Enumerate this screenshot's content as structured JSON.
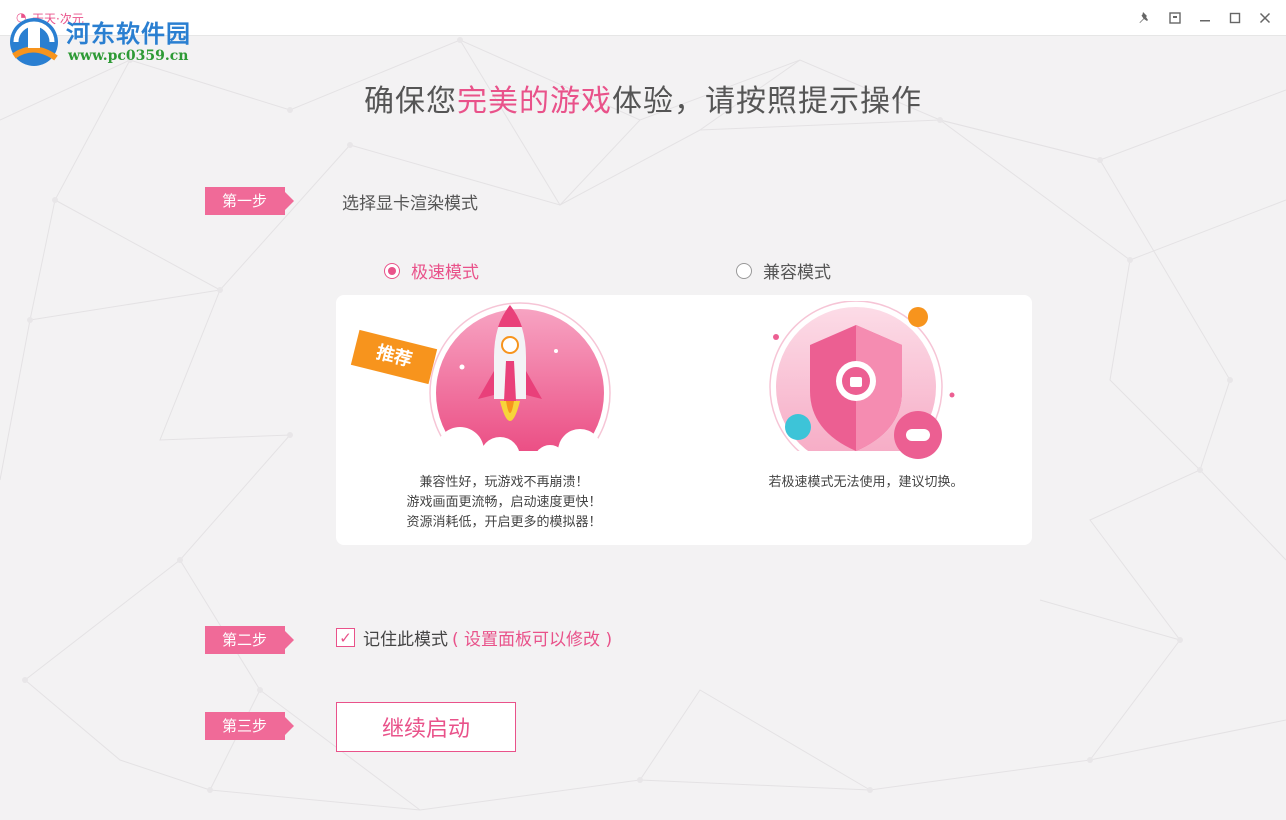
{
  "window": {
    "app_title": "天天·次元",
    "controls": [
      "pin-icon",
      "restore-down-icon",
      "minimize-icon",
      "maximize-icon",
      "close-icon"
    ]
  },
  "watermark": {
    "name": "河东软件园",
    "url": "www.pc0359.cn"
  },
  "headline": {
    "before": "确保您",
    "highlight": "完美的游戏",
    "after": "体验，请按照提示操作"
  },
  "steps": [
    {
      "tag": "第一步",
      "text": "选择显卡渲染模式"
    },
    {
      "tag": "第二步"
    },
    {
      "tag": "第三步"
    }
  ],
  "modes": [
    {
      "label": "极速模式",
      "selected": true,
      "badge": "推荐",
      "desc": [
        "兼容性好，玩游戏不再崩溃！",
        "游戏画面更流畅，启动速度更快！",
        "资源消耗低，开启更多的模拟器！"
      ]
    },
    {
      "label": "兼容模式",
      "selected": false,
      "desc": [
        "若极速模式无法使用，建议切换。"
      ]
    }
  ],
  "remember": {
    "checked": true,
    "label": "记住此模式",
    "note": "( 设置面板可以修改 )"
  },
  "continue_label": "继续启动",
  "colors": {
    "accent": "#e9528a",
    "step_tag": "#f06a98",
    "background": "#f3f2f3",
    "badge": "#f7941d"
  }
}
